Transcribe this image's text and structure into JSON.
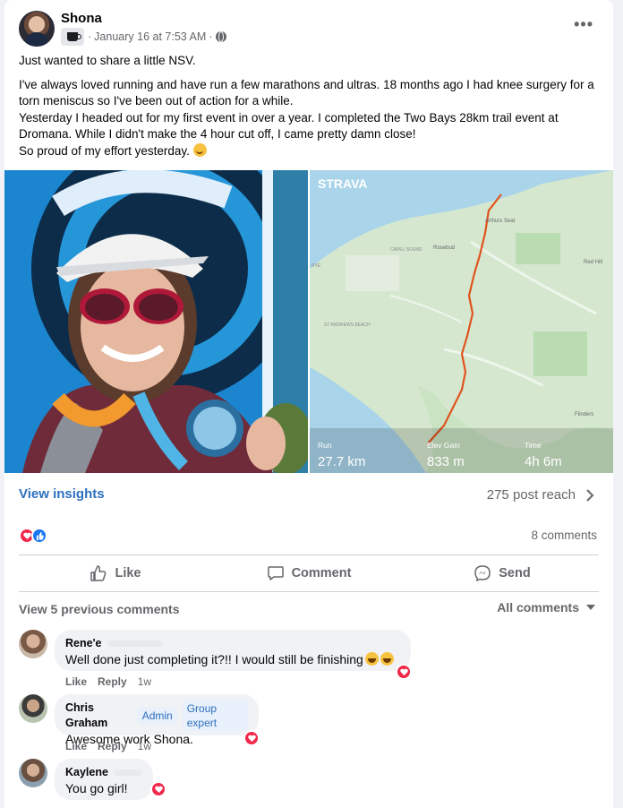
{
  "post": {
    "author": "Shona",
    "date": "January 16 at 7:53 AM",
    "dot": "·",
    "more": "•••",
    "text_lines": [
      "Just wanted to share a little NSV.",
      "I've always loved running and have run a few marathons and ultras. 18 months ago I had knee surgery for a torn meniscus so I've been out of action for a while.",
      "Yesterday I headed out for my first event in over a year. I completed the Two Bays 28km trail event at Dromana. While I didn't make the 4 hour cut off, I came pretty damn close!",
      "So proud of my effort yesterday."
    ]
  },
  "strava": {
    "logo": "STRAVA",
    "places": [
      "Arthurs Seat",
      "Rosebud",
      "CAPEL SOUND",
      "Red Hill",
      "RYE",
      "ST ANDREWS BEACH",
      "Flinders"
    ],
    "stats": [
      {
        "label": "Run",
        "value": "27.7 km"
      },
      {
        "label": "Elev Gain",
        "value": "833 m"
      },
      {
        "label": "Time",
        "value": "4h 6m"
      }
    ]
  },
  "insights": {
    "link": "View insights",
    "reach": "275 post reach",
    "comments_count": "8 comments"
  },
  "actions": {
    "like": "Like",
    "comment": "Comment",
    "send": "Send"
  },
  "comments_section": {
    "view_previous": "View 5 previous comments",
    "filter": "All comments"
  },
  "comments": [
    {
      "name": "Rene'e",
      "text": "Well done just completing it?!! I would still be finishing",
      "like": "Like",
      "reply": "Reply",
      "time": "1w"
    },
    {
      "name": "Chris Graham",
      "badge1": "Admin",
      "badge2": "Group expert",
      "text": "Awesome work Shona.",
      "like": "Like",
      "reply": "Reply",
      "time": "1w"
    },
    {
      "name": "Kaylene",
      "text": "You go girl!"
    }
  ],
  "colors": {
    "accent_blue": "#2d6fbf",
    "love_red": "#f0284a",
    "like_blue": "#1877f2",
    "strava_route": "#e0531f"
  }
}
